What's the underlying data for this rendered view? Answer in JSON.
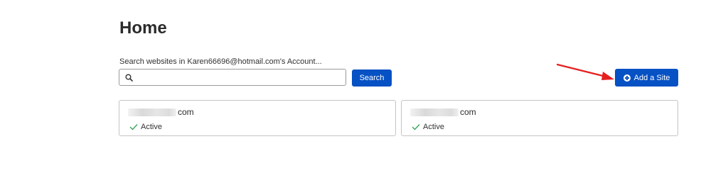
{
  "page": {
    "title": "Home"
  },
  "search": {
    "label": "Search websites in Karen66696@hotmail.com's Account...",
    "value": "",
    "placeholder": "",
    "button_label": "Search"
  },
  "actions": {
    "add_site_label": "Add a Site"
  },
  "sites": [
    {
      "name_suffix": "com",
      "status": "Active"
    },
    {
      "name_suffix": "com",
      "status": "Active"
    }
  ],
  "colors": {
    "primary": "#0651c4",
    "annotation_arrow": "#e62020",
    "status_check": "#3aa55c"
  },
  "icons": {
    "search": "search-icon",
    "add": "plus-circle-icon",
    "status": "checkmark-icon"
  }
}
